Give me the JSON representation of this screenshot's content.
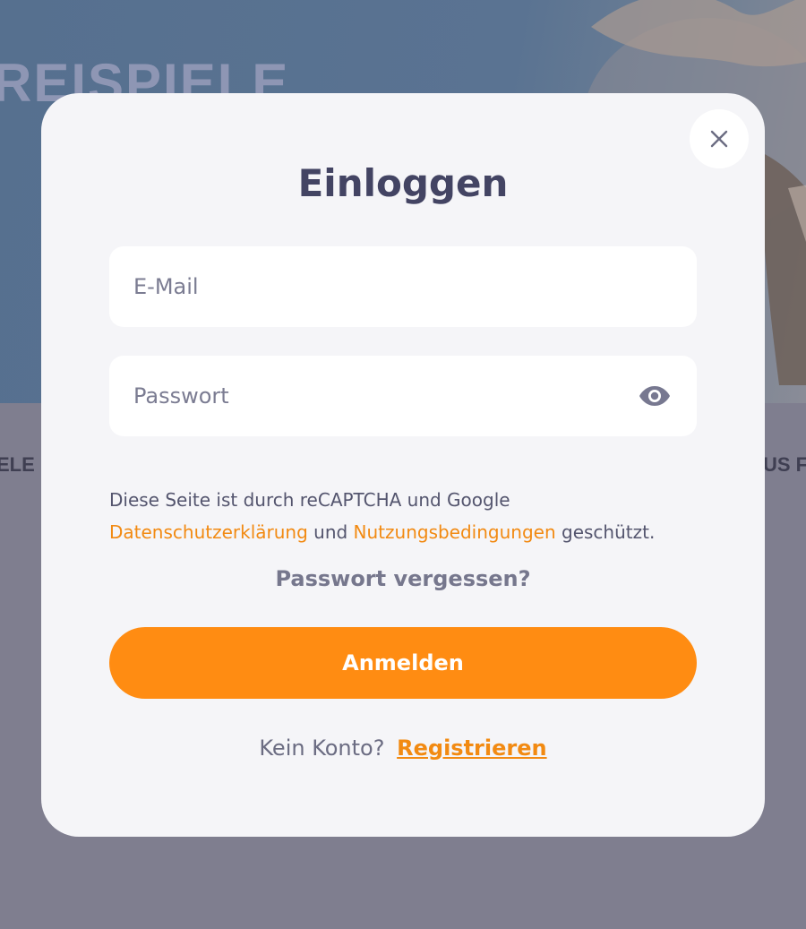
{
  "background": {
    "hero_title": "REISPIELE",
    "left_text": "ELE",
    "right_text": "US F"
  },
  "modal": {
    "title": "Einloggen",
    "close_icon": "close-icon",
    "email": {
      "placeholder": "E-Mail",
      "value": ""
    },
    "password": {
      "placeholder": "Passwort",
      "value": "",
      "toggle_icon": "eye-icon"
    },
    "recaptcha": {
      "prefix": "Diese Seite ist durch reCAPTCHA und Google",
      "privacy_link": "Datenschutzerklärung",
      "and": "und",
      "terms_link": "Nutzungsbedingungen",
      "suffix": "geschützt."
    },
    "forgot_password": "Passwort vergessen?",
    "submit_label": "Anmelden",
    "no_account_text": "Kein Konto?",
    "register_link": "Registrieren"
  },
  "colors": {
    "accent": "#ff8c12",
    "link": "#f28a12",
    "title": "#434463",
    "modal_bg": "#f5f5f8",
    "overlay": "#7f7e8f"
  }
}
